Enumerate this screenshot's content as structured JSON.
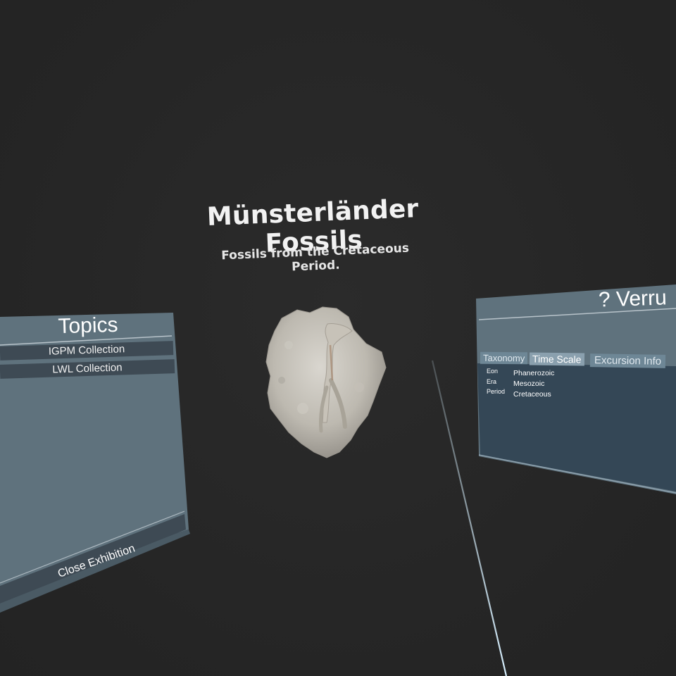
{
  "exhibition": {
    "title": "Münsterländer Fossils",
    "subtitle": "Fossils from the Cretaceous Period."
  },
  "topics_panel": {
    "title": "Topics",
    "items": [
      {
        "label": "IGPM Collection"
      },
      {
        "label": "LWL Collection"
      }
    ],
    "close_label": "Close Exhibition"
  },
  "info_panel": {
    "title": "? Verru",
    "tabs": [
      {
        "label": "Taxonomy",
        "active": false
      },
      {
        "label": "Time Scale",
        "active": true
      },
      {
        "label": "Excursion Info",
        "active": false
      }
    ],
    "rows": [
      {
        "key": "Eon",
        "value": "Phanerozoic"
      },
      {
        "key": "Era",
        "value": "Mesozoic"
      },
      {
        "key": "Period",
        "value": "Cretaceous"
      }
    ]
  },
  "fossil": {
    "icon": "fossil-specimen"
  },
  "colors": {
    "background": "#262626",
    "panel_light": "#5f727d",
    "panel_dark": "#344756",
    "button": "#3e4a54",
    "laser": "#cfe8f5"
  }
}
